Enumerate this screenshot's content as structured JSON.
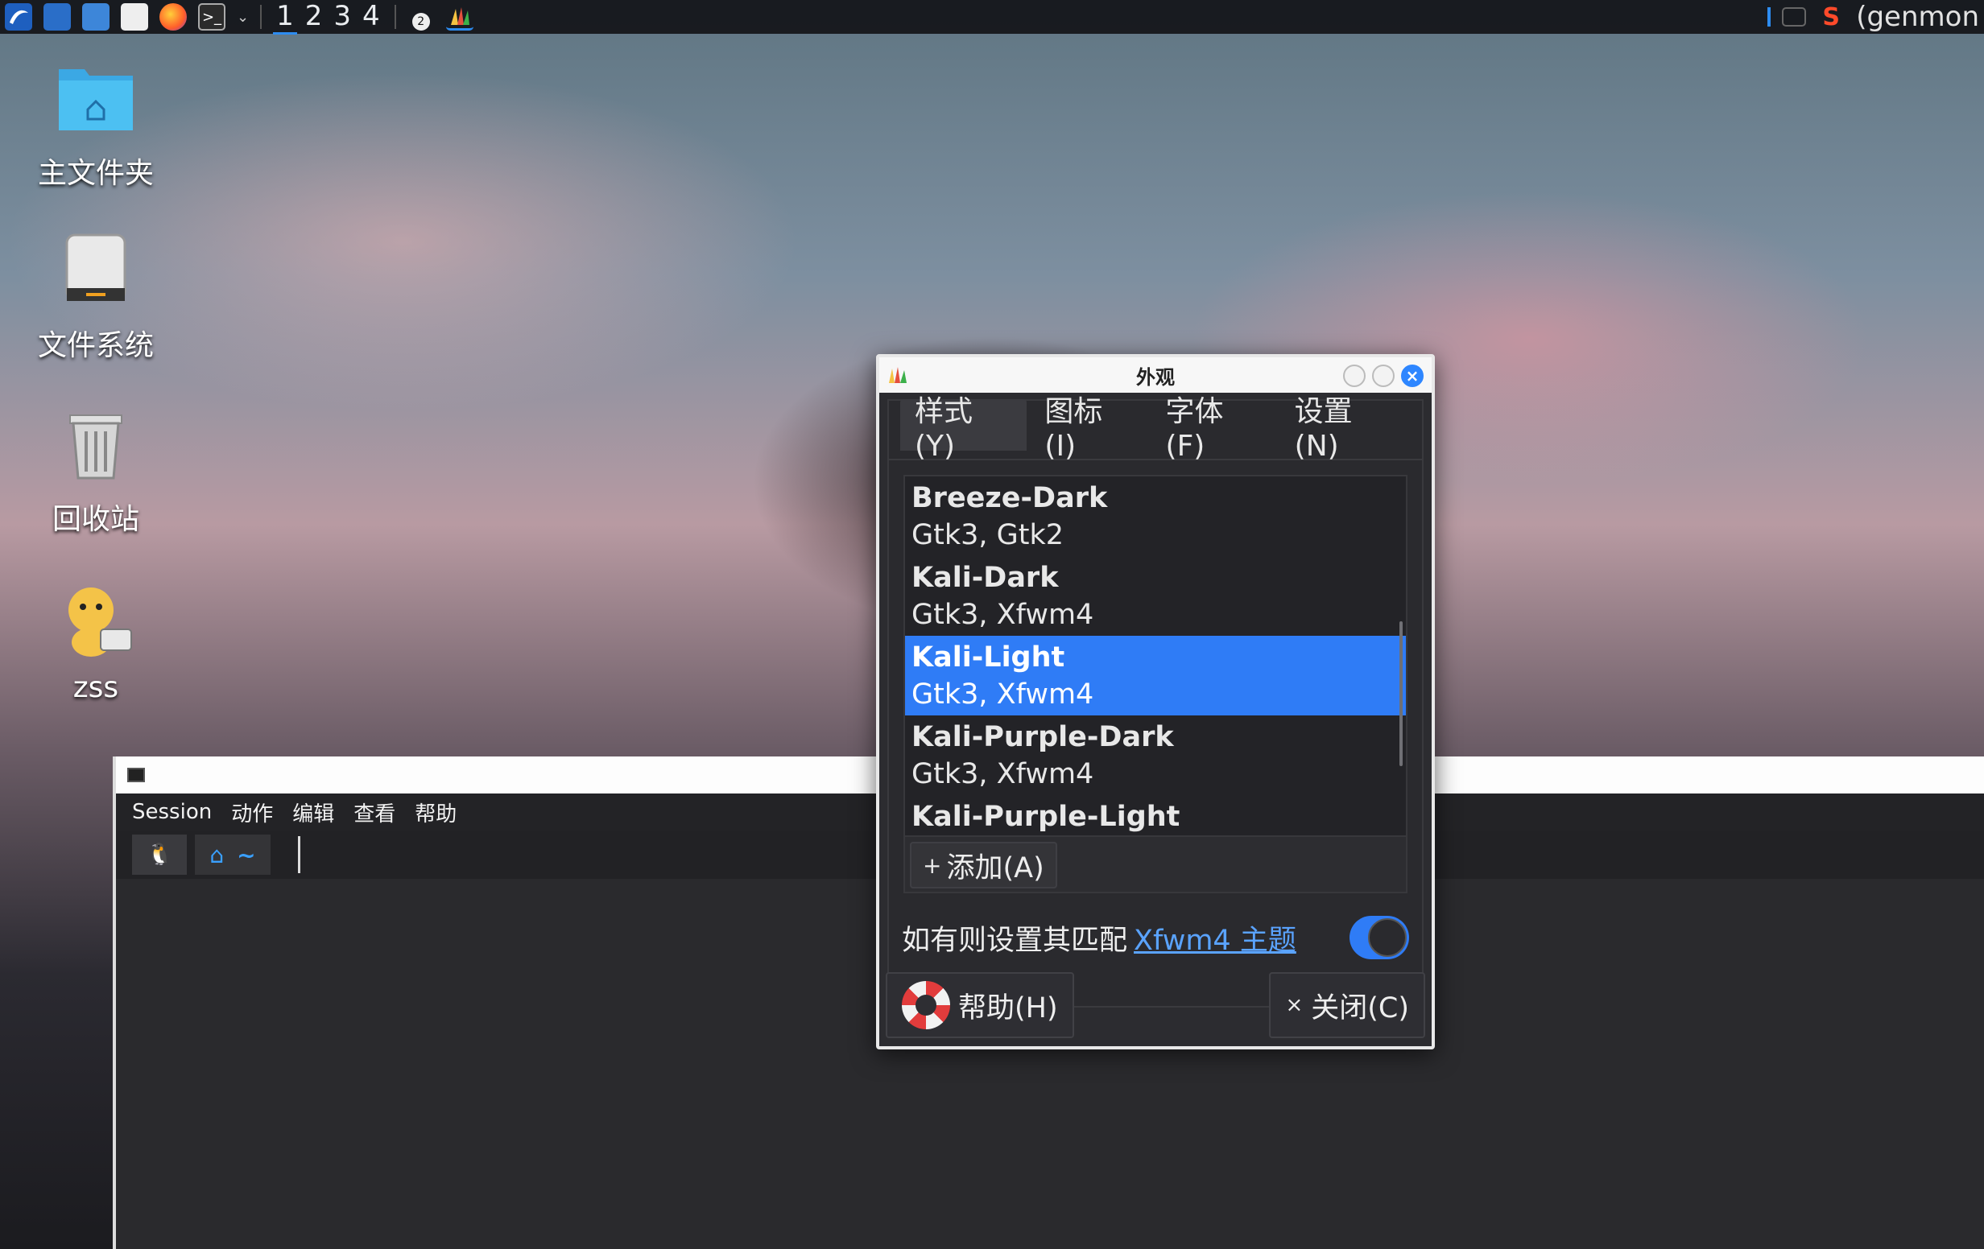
{
  "panel": {
    "workspaces": [
      "1",
      "2",
      "3",
      "4"
    ],
    "active_workspace": "1",
    "notification_badge": "2",
    "genmon_label": "(genmon",
    "icons": [
      "kali-menu-icon",
      "show-desktop-icon",
      "files-icon",
      "text-editor-icon",
      "firefox-icon",
      "terminal-icon",
      "appearance-icon"
    ]
  },
  "desktop": {
    "icons": [
      {
        "label": "主文件夹",
        "icon": "home-folder-icon"
      },
      {
        "label": "文件系统",
        "icon": "drive-icon"
      },
      {
        "label": "回收站",
        "icon": "trash-icon"
      },
      {
        "label": "zss",
        "icon": "user-link-icon"
      }
    ]
  },
  "terminal": {
    "menu": [
      "Session",
      "动作",
      "编辑",
      "查看",
      "帮助"
    ],
    "prompt_home": "⌂",
    "prompt_tilde": "~"
  },
  "dialog": {
    "title": "外观",
    "tabs": [
      "样式(Y)",
      "图标(I)",
      "字体(F)",
      "设置(N)"
    ],
    "active_tab": "样式(Y)",
    "themes": [
      {
        "name": "Breeze-Dark",
        "sub": "Gtk3, Gtk2"
      },
      {
        "name": "Kali-Dark",
        "sub": "Gtk3, Xfwm4"
      },
      {
        "name": "Kali-Light",
        "sub": "Gtk3, Xfwm4"
      },
      {
        "name": "Kali-Purple-Dark",
        "sub": "Gtk3, Xfwm4"
      },
      {
        "name": "Kali-Purple-Light",
        "sub": ""
      }
    ],
    "selected_theme": "Kali-Light",
    "add_button": "添加(A)",
    "match_text": "如有则设置其匹配",
    "match_link": "Xfwm4 主题",
    "match_toggle_on": true,
    "help_button": "帮助(H)",
    "close_button": "关闭(C)",
    "accent_color": "#2f7cf6"
  }
}
